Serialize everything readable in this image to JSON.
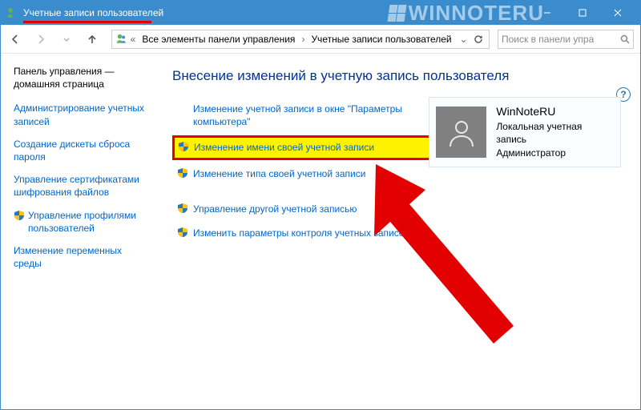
{
  "window": {
    "title": "Учетные записи пользователей",
    "watermark": "WINNOTERU"
  },
  "breadcrumb": {
    "sep_first": "«",
    "item1": "Все элементы панели управления",
    "item2": "Учетные записи пользователей"
  },
  "search": {
    "placeholder": "Поиск в панели упра"
  },
  "sidebar": {
    "home": "Панель управления — домашняя страница",
    "items": [
      {
        "label": "Администрирование учетных записей",
        "shield": false
      },
      {
        "label": "Создание дискеты сброса пароля",
        "shield": false
      },
      {
        "label": "Управление сертификатами шифрования файлов",
        "shield": false
      },
      {
        "label": "Управление профилями пользователей",
        "shield": true
      },
      {
        "label": "Изменение переменных среды",
        "shield": false
      }
    ]
  },
  "main": {
    "heading": "Внесение изменений в учетную запись пользователя",
    "actions": [
      {
        "label": "Изменение учетной записи в окне \"Параметры компьютера\"",
        "shield": false,
        "highlight": false,
        "spaced": false
      },
      {
        "label": "Изменение имени своей учетной записи",
        "shield": true,
        "highlight": true,
        "spaced": false
      },
      {
        "label": "Изменение типа своей учетной записи",
        "shield": true,
        "highlight": false,
        "spaced": false
      },
      {
        "label": "Управление другой учетной записью",
        "shield": true,
        "highlight": false,
        "spaced": true
      },
      {
        "label": "Изменить параметры контроля учетных записей",
        "shield": true,
        "highlight": false,
        "spaced": false
      }
    ]
  },
  "user": {
    "name": "WinNoteRU",
    "type": "Локальная учетная запись",
    "role": "Администратор"
  },
  "help": {
    "label": "?"
  },
  "icons": {
    "shield_colors": {
      "tl": "#2a7ab0",
      "tr": "#ffc20e",
      "bl": "#ffc20e",
      "br": "#2a7ab0"
    }
  }
}
